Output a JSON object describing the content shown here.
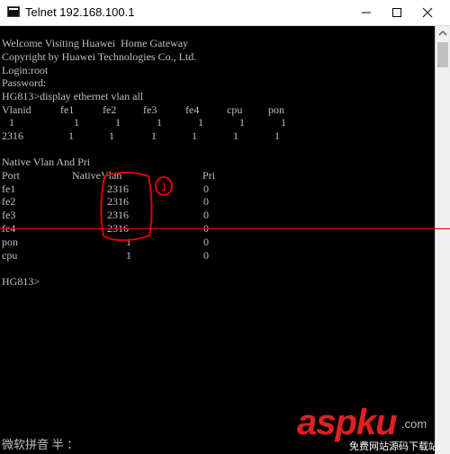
{
  "window": {
    "title": "Telnet 192.168.100.1"
  },
  "console": {
    "lines": [
      "Welcome Visiting Huawei  Home Gateway",
      "Copyright by Huawei Technologies Co., Ltd.",
      "Login:root",
      "Password:",
      "HG813>display ethernet vlan all"
    ],
    "vlan_table": {
      "headers": [
        "Vlanid",
        "fe1",
        "fe2",
        "fe3",
        "fe4",
        "cpu",
        "pon"
      ],
      "rows": [
        [
          "1",
          "1",
          "1",
          "1",
          "1",
          "1",
          "1"
        ],
        [
          "2316",
          "1",
          "1",
          "1",
          "1",
          "1",
          "1"
        ]
      ]
    },
    "native_section_title": "Native Vlan And Pri",
    "native_table": {
      "headers": [
        "Port",
        "NativeVlan",
        "Pri"
      ],
      "rows": [
        [
          "fe1",
          "2316",
          "0"
        ],
        [
          "fe2",
          "2316",
          "0"
        ],
        [
          "fe3",
          "2316",
          "0"
        ],
        [
          "fe4",
          "2316",
          "0"
        ],
        [
          "pon",
          "1",
          "0"
        ],
        [
          "cpu",
          "1",
          "0"
        ]
      ]
    },
    "prompt": "HG813>"
  },
  "annotation": {
    "mark": "1",
    "color": "#e00000"
  },
  "ime_status": "微软拼音 半 ：",
  "watermark": {
    "logo": "aspku",
    "tld": ".com",
    "subtitle": "免费网站源码下载站!"
  }
}
